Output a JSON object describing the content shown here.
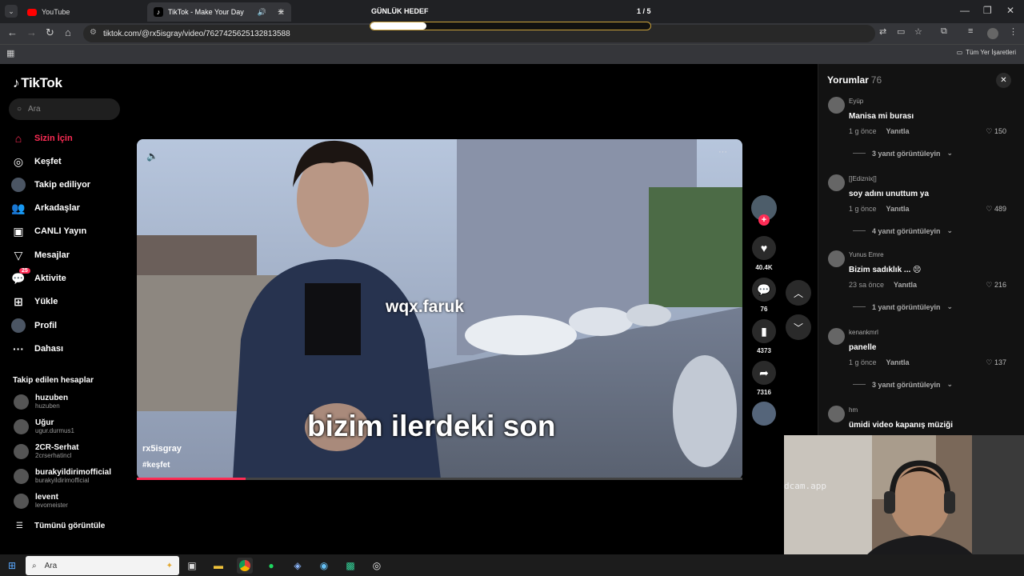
{
  "browser": {
    "tabs": [
      {
        "label": "YouTube",
        "active": false
      },
      {
        "label": "TikTok - Make Your Day",
        "active": true
      }
    ],
    "url": "tiktok.com/@rx5isgray/video/7627425625132813588",
    "bookmarks_label": "Tüm Yer İşaretleri"
  },
  "overlay": {
    "goal_label": "GÜNLÜK HEDEF",
    "goal_count": "1 / 5",
    "goal_progress": 0.2
  },
  "sidebar": {
    "logo": "TikTok",
    "search_placeholder": "Ara",
    "nav": [
      {
        "label": "Sizin İçin",
        "icon": "home-icon",
        "active": true
      },
      {
        "label": "Keşfet",
        "icon": "compass-icon"
      },
      {
        "label": "Takip ediliyor",
        "icon": "following-avatar-icon"
      },
      {
        "label": "Arkadaşlar",
        "icon": "friends-icon"
      },
      {
        "label": "CANLI Yayın",
        "icon": "live-icon"
      },
      {
        "label": "Mesajlar",
        "icon": "messages-icon"
      },
      {
        "label": "Aktivite",
        "icon": "activity-icon",
        "badge": "25"
      },
      {
        "label": "Yükle",
        "icon": "upload-icon"
      },
      {
        "label": "Profil",
        "icon": "profile-icon"
      },
      {
        "label": "Dahası",
        "icon": "more-icon"
      }
    ],
    "following_title": "Takip edilen hesaplar",
    "accounts": [
      {
        "name": "huzuben",
        "handle": "huzuben"
      },
      {
        "name": "Uğur",
        "handle": "ugur.durmus1"
      },
      {
        "name": "2CR-Serhat",
        "handle": "2crserhatincl"
      },
      {
        "name": "burakyildirimofficial",
        "handle": "burakyildirimofficial"
      },
      {
        "name": "levent",
        "handle": "levomeister"
      }
    ],
    "see_all": "Tümünü görüntüle"
  },
  "video": {
    "author": "rx5isgray",
    "hashtag": "#keşfet",
    "watermark": "wqx.faruk",
    "caption": "bizim ilerdeki son",
    "progress": 0.18
  },
  "rail": {
    "likes": "40.4K",
    "comments": "76",
    "saves": "4373",
    "shares": "7316"
  },
  "comments": {
    "title": "Yorumlar",
    "count": "76",
    "reply_label": "Yanıtla",
    "items": [
      {
        "user": "Eyüp",
        "text": "Manisa mi burası",
        "time": "1 g önce",
        "likes": "150",
        "replies": "3 yanıt görüntüleyin"
      },
      {
        "user": "[]Ediznix[]",
        "text": "soy adını unuttum ya",
        "time": "1 g önce",
        "likes": "489",
        "replies": "4 yanıt görüntüleyin"
      },
      {
        "user": "Yunus Emre",
        "text": "Bizim sadıklık ... 😣",
        "time": "23 sa önce",
        "likes": "216",
        "replies": "1 yanıt görüntüleyin"
      },
      {
        "user": "kenankmrl",
        "text": "panelle",
        "time": "1 g önce",
        "likes": "137",
        "replies": "3 yanıt görüntüleyin"
      },
      {
        "user": "hm",
        "text": "ümidi video kapanış müziği"
      }
    ]
  },
  "webcam": {
    "watermark": "dcam.app"
  },
  "taskbar": {
    "search_placeholder": "Ara"
  }
}
